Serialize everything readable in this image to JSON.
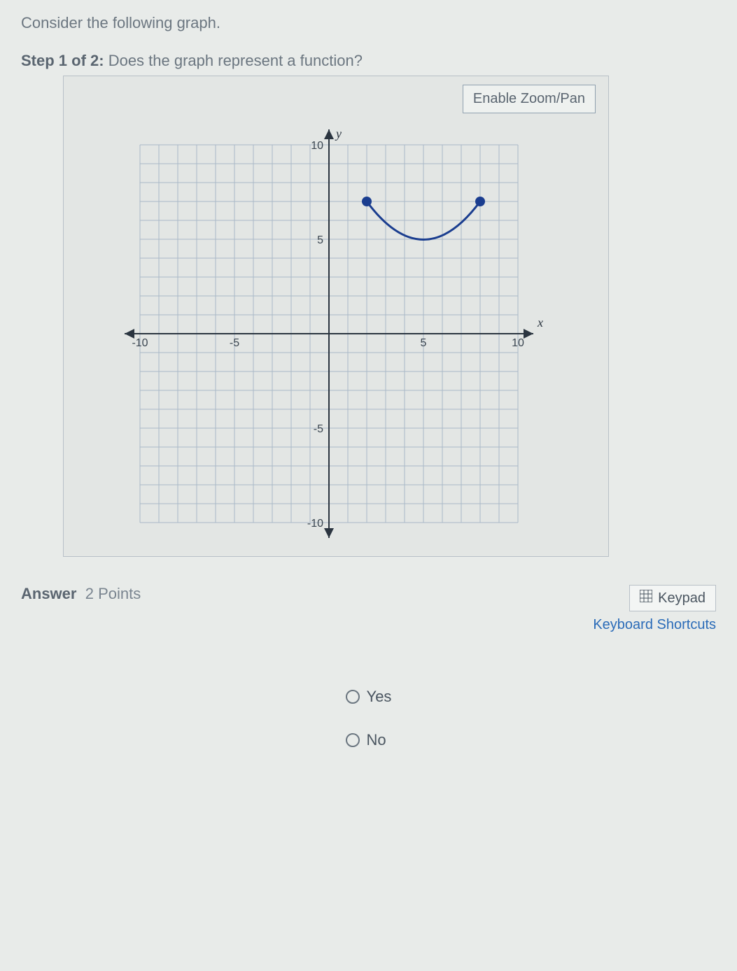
{
  "intro": "Consider the following graph.",
  "step": {
    "label": "Step 1 of 2:",
    "question": "Does the graph represent a function?"
  },
  "zoom_btn": "Enable Zoom/Pan",
  "axes": {
    "x_label": "x",
    "y_label": "y",
    "ticks": {
      "neg10": "-10",
      "neg5": "-5",
      "pos5": "5",
      "pos10": "10",
      "yneg10": "-10",
      "yneg5": "-5",
      "ypos5": "5",
      "ypos10": "10"
    }
  },
  "chart_data": {
    "type": "curve",
    "description": "Upward-opening arc segment with closed endpoints",
    "points": [
      {
        "x": 2,
        "y": 7
      },
      {
        "x": 3,
        "y": 5.2
      },
      {
        "x": 4,
        "y": 4.2
      },
      {
        "x": 5,
        "y": 4
      },
      {
        "x": 6,
        "y": 4.2
      },
      {
        "x": 7,
        "y": 5.2
      },
      {
        "x": 8,
        "y": 7
      }
    ],
    "endpoints_closed": true,
    "xlim": [
      -10,
      10
    ],
    "ylim": [
      -10,
      10
    ]
  },
  "answer": {
    "label": "Answer",
    "points": "2 Points"
  },
  "keypad": "Keypad",
  "shortcuts": "Keyboard Shortcuts",
  "options": {
    "yes": "Yes",
    "no": "No"
  }
}
